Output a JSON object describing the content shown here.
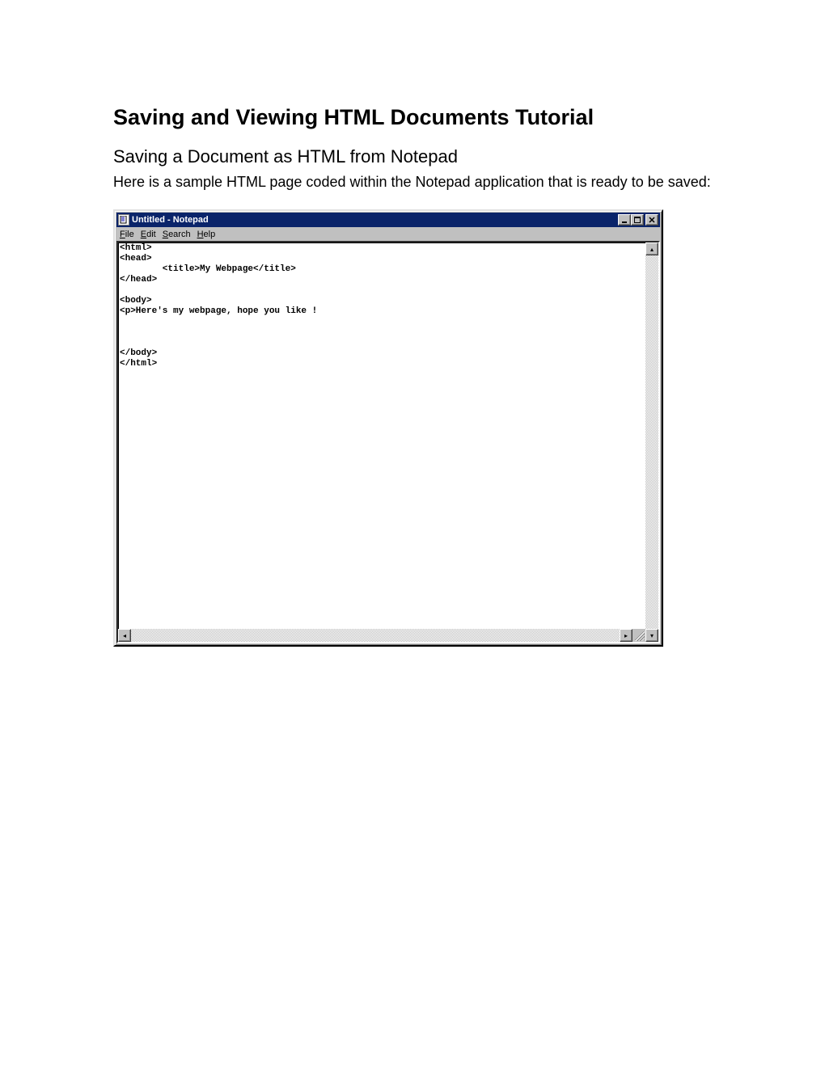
{
  "doc": {
    "title": "Saving and Viewing HTML Documents Tutorial",
    "subtitle": "Saving a Document as HTML from Notepad",
    "intro": "Here is a sample HTML page coded within the Notepad application that is ready to be saved:"
  },
  "notepad": {
    "window_title": "Untitled - Notepad",
    "menus": {
      "file": "File",
      "edit": "Edit",
      "search": "Search",
      "help": "Help"
    },
    "content": "<html>\n<head>\n        <title>My Webpage</title>\n</head>\n\n<body>\n<p>Here's my webpage, hope you like !\n\n\n\n</body>\n</html>"
  }
}
